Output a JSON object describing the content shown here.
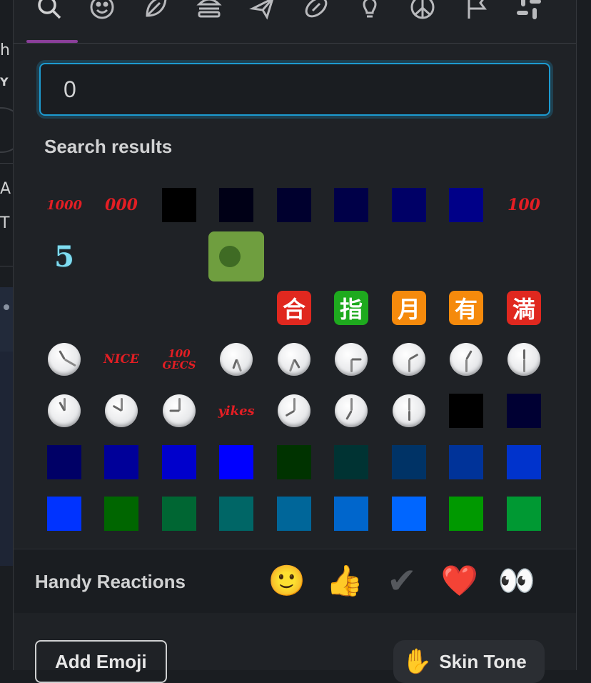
{
  "background": {
    "fragments": [
      "h",
      "Y",
      "A",
      "T"
    ]
  },
  "categories": [
    {
      "name": "search-icon",
      "label": "Search"
    },
    {
      "name": "smiley-icon",
      "label": "Smileys"
    },
    {
      "name": "leaf-icon",
      "label": "Nature"
    },
    {
      "name": "burger-icon",
      "label": "Food"
    },
    {
      "name": "airplane-icon",
      "label": "Travel"
    },
    {
      "name": "football-icon",
      "label": "Activities"
    },
    {
      "name": "lightbulb-icon",
      "label": "Objects"
    },
    {
      "name": "peace-icon",
      "label": "Symbols"
    },
    {
      "name": "flag-icon",
      "label": "Flags"
    },
    {
      "name": "slack-icon",
      "label": "Custom"
    }
  ],
  "search": {
    "value": "0",
    "placeholder": ""
  },
  "section_title": "Search results",
  "results": [
    {
      "kind": "text",
      "text": "1000",
      "color": "#e31e24",
      "name": "emoji-1000"
    },
    {
      "kind": "text",
      "text": "000",
      "color": "#e31e24",
      "name": "emoji-000"
    },
    {
      "kind": "color",
      "color": "#000000",
      "name": "emoji-color-square"
    },
    {
      "kind": "color",
      "color": "#000016",
      "name": "emoji-color-square"
    },
    {
      "kind": "color",
      "color": "#00002e",
      "name": "emoji-color-square"
    },
    {
      "kind": "color",
      "color": "#000048",
      "name": "emoji-color-square"
    },
    {
      "kind": "color",
      "color": "#000066",
      "name": "emoji-color-square"
    },
    {
      "kind": "color",
      "color": "#000088",
      "name": "emoji-color-square"
    },
    {
      "kind": "text",
      "text": "100",
      "color": "#e31e24",
      "name": "emoji-100"
    },
    {
      "kind": "text",
      "text": "5",
      "color": "#7fdcf0",
      "name": "emoji-five"
    },
    {
      "kind": "empty",
      "name": "emoji-blank"
    },
    {
      "kind": "empty",
      "name": "emoji-blank"
    },
    {
      "kind": "selected",
      "name": "emoji-green-dot"
    },
    {
      "kind": "empty",
      "name": "emoji-blank"
    },
    {
      "kind": "empty",
      "name": "emoji-blank"
    },
    {
      "kind": "empty",
      "name": "emoji-blank"
    },
    {
      "kind": "empty",
      "name": "emoji-blank"
    },
    {
      "kind": "empty",
      "name": "emoji-blank"
    },
    {
      "kind": "empty",
      "name": "emoji-blank"
    },
    {
      "kind": "empty",
      "name": "emoji-blank"
    },
    {
      "kind": "empty",
      "name": "emoji-blank"
    },
    {
      "kind": "empty",
      "name": "emoji-blank"
    },
    {
      "kind": "cjk",
      "text": "合",
      "color": "#e0281f",
      "name": "emoji-cjk-agreement"
    },
    {
      "kind": "cjk",
      "text": "指",
      "color": "#1eaa1e",
      "name": "emoji-cjk-reserved"
    },
    {
      "kind": "cjk",
      "text": "月",
      "color": "#f58a0c",
      "name": "emoji-cjk-monthly"
    },
    {
      "kind": "cjk",
      "text": "有",
      "color": "#f58a0c",
      "name": "emoji-cjk-not-free"
    },
    {
      "kind": "cjk",
      "text": "満",
      "color": "#e0281f",
      "name": "emoji-cjk-no-vacancy"
    },
    {
      "kind": "clock",
      "h": -30,
      "m": 120,
      "name": "emoji-clock"
    },
    {
      "kind": "text",
      "text": "NICE",
      "color": "#e31e24",
      "name": "emoji-nice"
    },
    {
      "kind": "text",
      "text": "100 GECS",
      "color": "#e31e24",
      "name": "emoji-100gecs"
    },
    {
      "kind": "clock",
      "h": 200,
      "m": 160,
      "name": "emoji-clock"
    },
    {
      "kind": "clock",
      "h": 150,
      "m": 200,
      "name": "emoji-clock"
    },
    {
      "kind": "clock",
      "h": 90,
      "m": 180,
      "name": "emoji-clock"
    },
    {
      "kind": "clock",
      "h": 60,
      "m": 180,
      "name": "emoji-clock"
    },
    {
      "kind": "clock",
      "h": 30,
      "m": 180,
      "name": "emoji-clock"
    },
    {
      "kind": "clock",
      "h": 0,
      "m": 180,
      "name": "emoji-clock"
    },
    {
      "kind": "clock",
      "h": -30,
      "m": 0,
      "name": "emoji-clock"
    },
    {
      "kind": "clock",
      "h": -60,
      "m": 0,
      "name": "emoji-clock"
    },
    {
      "kind": "clock",
      "h": -90,
      "m": 0,
      "name": "emoji-clock"
    },
    {
      "kind": "text",
      "text": "yikes",
      "color": "#e31e24",
      "name": "emoji-yikes"
    },
    {
      "kind": "clock",
      "h": -120,
      "m": 0,
      "name": "emoji-clock"
    },
    {
      "kind": "clock",
      "h": -150,
      "m": 0,
      "name": "emoji-clock"
    },
    {
      "kind": "clock",
      "h": 180,
      "m": 0,
      "name": "emoji-clock"
    },
    {
      "kind": "color",
      "color": "#000000",
      "name": "emoji-color-square"
    },
    {
      "kind": "color",
      "color": "#000033",
      "name": "emoji-color-square"
    },
    {
      "kind": "color",
      "color": "#000066",
      "name": "emoji-color-square"
    },
    {
      "kind": "color",
      "color": "#000099",
      "name": "emoji-color-square"
    },
    {
      "kind": "color",
      "color": "#0000cc",
      "name": "emoji-color-square"
    },
    {
      "kind": "color",
      "color": "#0000ff",
      "name": "emoji-color-square"
    },
    {
      "kind": "color",
      "color": "#003300",
      "name": "emoji-color-square"
    },
    {
      "kind": "color",
      "color": "#003333",
      "name": "emoji-color-square"
    },
    {
      "kind": "color",
      "color": "#003366",
      "name": "emoji-color-square"
    },
    {
      "kind": "color",
      "color": "#003399",
      "name": "emoji-color-square"
    },
    {
      "kind": "color",
      "color": "#0033cc",
      "name": "emoji-color-square"
    },
    {
      "kind": "color",
      "color": "#0033ff",
      "name": "emoji-color-square"
    },
    {
      "kind": "color",
      "color": "#006600",
      "name": "emoji-color-square"
    },
    {
      "kind": "color",
      "color": "#006633",
      "name": "emoji-color-square"
    },
    {
      "kind": "color",
      "color": "#006666",
      "name": "emoji-color-square"
    },
    {
      "kind": "color",
      "color": "#006699",
      "name": "emoji-color-square"
    },
    {
      "kind": "color",
      "color": "#0066cc",
      "name": "emoji-color-square"
    },
    {
      "kind": "color",
      "color": "#0066ff",
      "name": "emoji-color-square"
    },
    {
      "kind": "color",
      "color": "#009900",
      "name": "emoji-color-square"
    },
    {
      "kind": "color",
      "color": "#009933",
      "name": "emoji-color-square"
    }
  ],
  "handy": {
    "label": "Handy Reactions",
    "items": [
      {
        "name": "slightly-smiling-face-icon",
        "glyph": "🙂"
      },
      {
        "name": "thumbs-up-icon",
        "glyph": "👍"
      },
      {
        "name": "check-mark-icon",
        "glyph": "✔"
      },
      {
        "name": "heart-icon",
        "glyph": "❤️"
      },
      {
        "name": "eyes-icon",
        "glyph": "👀"
      }
    ]
  },
  "footer": {
    "add_emoji": "Add Emoji",
    "skin_tone": "Skin Tone",
    "skin_glyph": "✋"
  },
  "colors": {
    "accent": "#1d9bd1",
    "tab_underline": "#8b3f9a",
    "selected": "#6f9e3f"
  }
}
